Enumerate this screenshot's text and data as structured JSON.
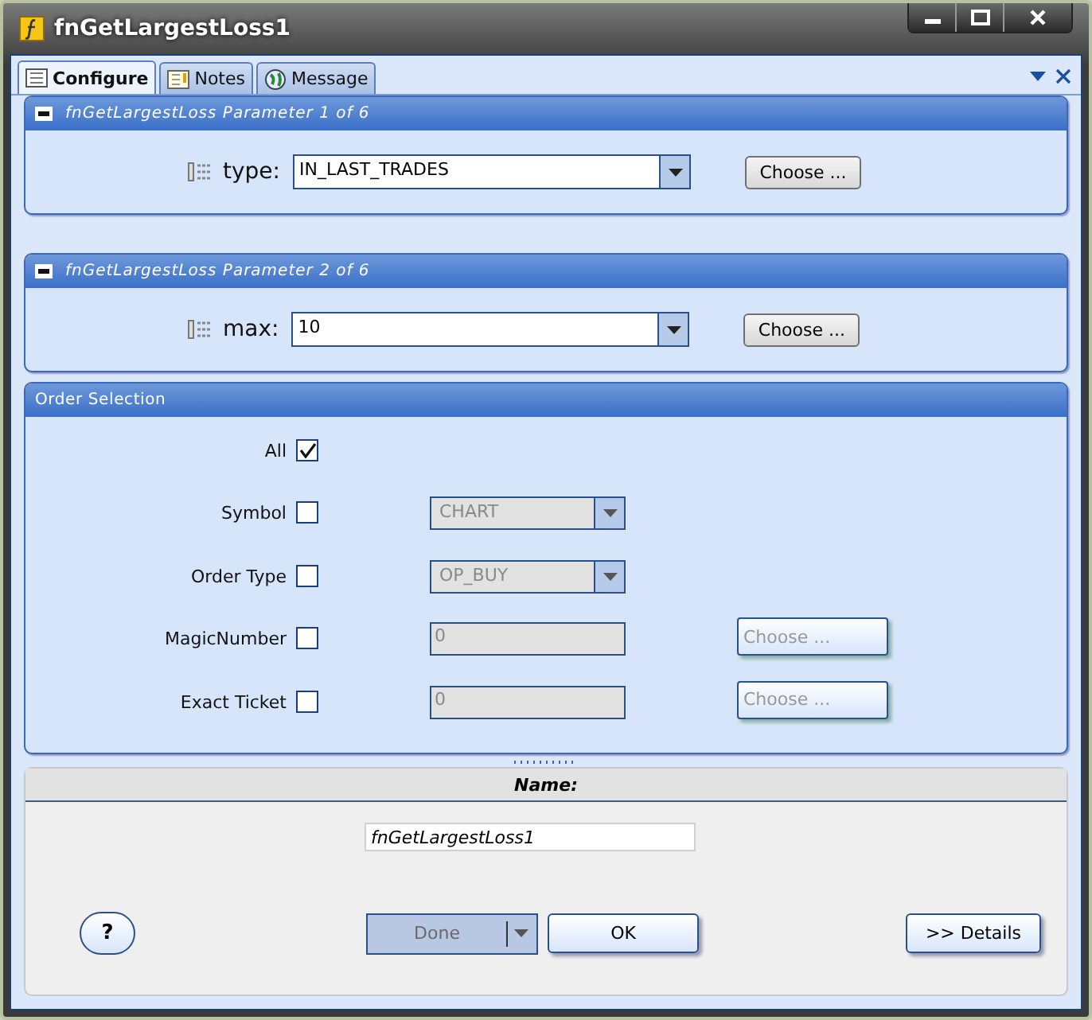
{
  "window": {
    "title": "fnGetLargestLoss1"
  },
  "tabs": [
    {
      "label": "Configure",
      "selected": true,
      "kind": "grid"
    },
    {
      "label": "Notes",
      "selected": false,
      "kind": "note"
    },
    {
      "label": "Message",
      "selected": false,
      "kind": "globe"
    }
  ],
  "parameters": [
    {
      "title": "fnGetLargestLoss Parameter 1 of 6",
      "label": "type:",
      "value": "IN_LAST_TRADES",
      "button": "Choose ..."
    },
    {
      "title": "fnGetLargestLoss Parameter 2 of 6",
      "label": "max:",
      "value": "10",
      "button": "Choose ..."
    }
  ],
  "order_selection": {
    "title": "Order Selection",
    "rows": [
      {
        "label": "All",
        "checked": true,
        "kind": "checkbox"
      },
      {
        "label": "Symbol",
        "checked": false,
        "kind": "dropdown",
        "value": "CHART",
        "disabled": true
      },
      {
        "label": "Order Type",
        "checked": false,
        "kind": "dropdown",
        "value": "OP_BUY",
        "disabled": true
      },
      {
        "label": "MagicNumber",
        "checked": false,
        "kind": "text",
        "value": "0",
        "disabled": true,
        "button": "Choose ..."
      },
      {
        "label": "Exact Ticket",
        "checked": false,
        "kind": "text",
        "value": "0",
        "disabled": true,
        "button": "Choose ..."
      }
    ]
  },
  "name": {
    "label": "Name:",
    "value": "fnGetLargestLoss1"
  },
  "buttons": {
    "help": "?",
    "done": {
      "label": "Done",
      "disabled": true
    },
    "ok": "OK",
    "details": ">> Details"
  }
}
